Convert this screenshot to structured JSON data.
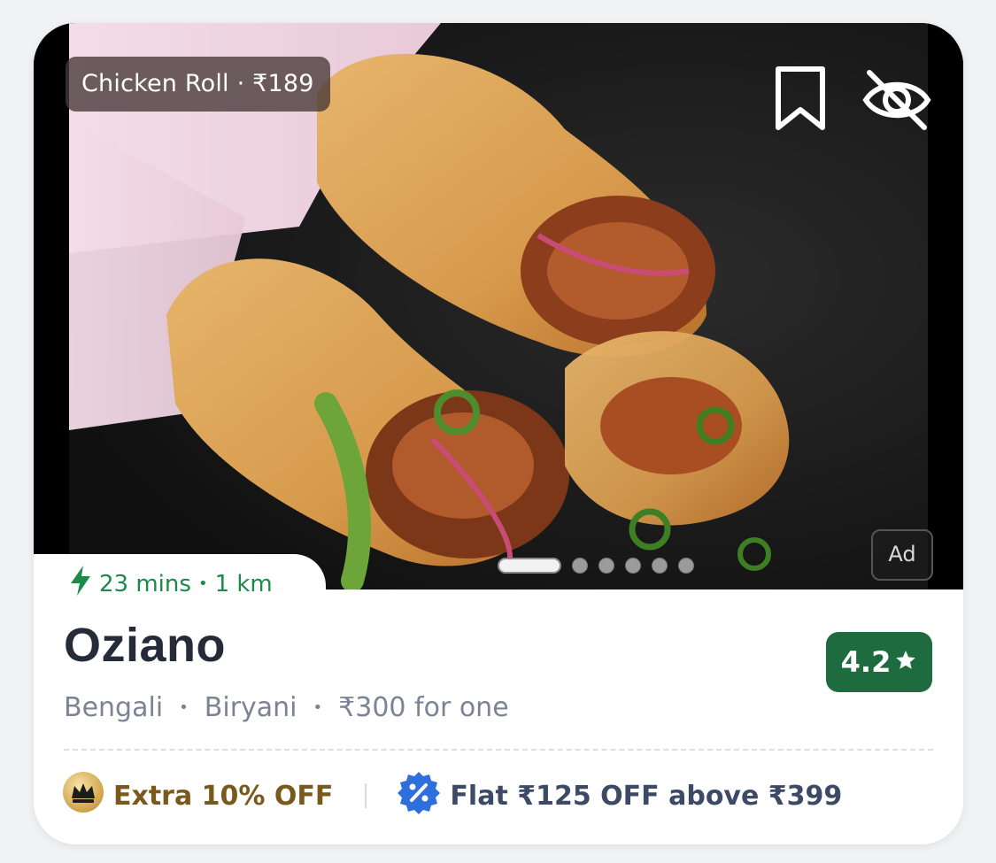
{
  "dish_tag": {
    "name": "Chicken Roll",
    "separator": "·",
    "price": "₹189"
  },
  "ad_label": "Ad",
  "carousel": {
    "total": 6,
    "active": 1
  },
  "eta": {
    "time": "23 mins",
    "separator": "•",
    "distance": "1 km"
  },
  "restaurant": {
    "name": "Oziano",
    "rating": "4.2",
    "cuisines": [
      "Bengali",
      "Biryani"
    ],
    "cost": "₹300 for one",
    "separator": "•"
  },
  "offers": {
    "membership": "Extra 10% OFF",
    "deal": "Flat ₹125 OFF above ₹399"
  },
  "icons": {
    "bookmark": "bookmark-icon",
    "hide": "eye-off-icon",
    "lightning": "lightning-icon",
    "star": "star-icon",
    "crown": "crown-icon",
    "discount": "discount-badge-icon"
  },
  "colors": {
    "rating_bg": "#1d6b3f",
    "eta_text": "#1b8a4a",
    "offer_gold": "#7a5a1c",
    "offer_blue": "#2f6fdc"
  }
}
